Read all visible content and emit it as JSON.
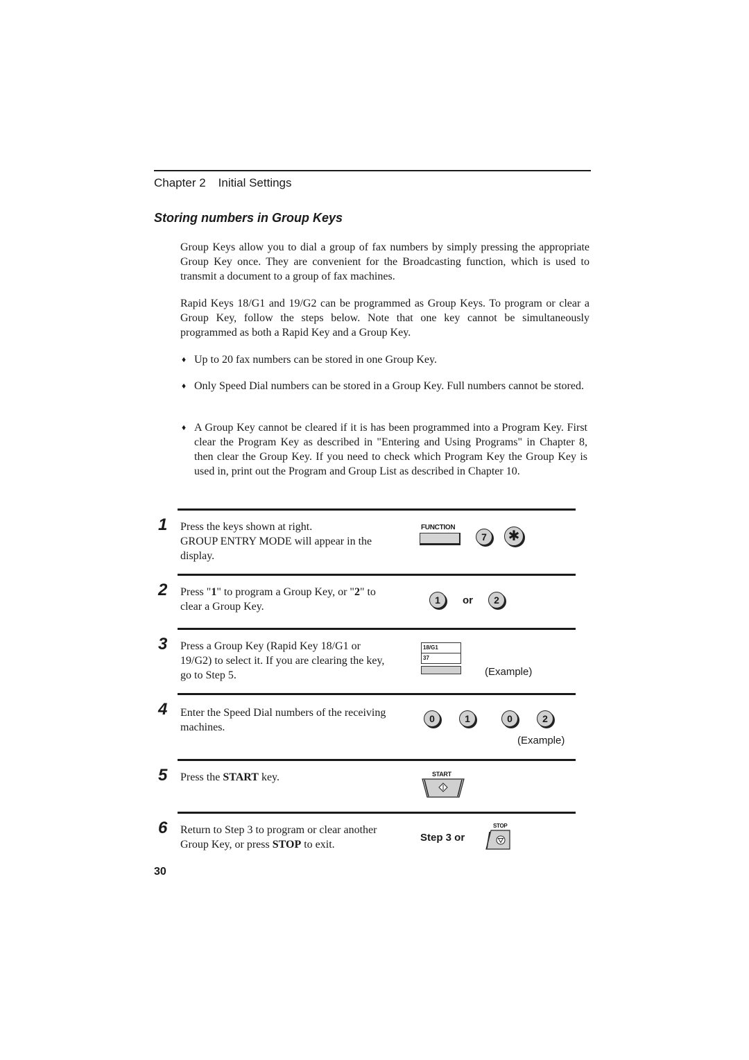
{
  "header": {
    "chapter_label": "Chapter 2",
    "chapter_title": "Initial Settings"
  },
  "section": {
    "title": "Storing numbers in Group Keys"
  },
  "intro": {
    "para1": "Group Keys allow you to dial a group of fax numbers by simply pressing the appropriate Group Key once. They are convenient for the Broadcasting function, which is used to transmit a document to a group of fax machines.",
    "para2": "Rapid Keys 18/G1 and 19/G2 can be programmed as Group Keys. To program or clear a Group Key, follow the steps below. Note that one key cannot be simultaneously programmed as both a Rapid Key and a Group Key."
  },
  "bullets": [
    {
      "icon": "diamond-bullet-icon",
      "glyph": "♦",
      "text": "Up to 20 fax numbers can be stored in one Group Key."
    },
    {
      "icon": "diamond-bullet-icon",
      "glyph": "♦",
      "text": "Only Speed Dial numbers can be stored in a Group Key. Full numbers cannot be stored."
    },
    {
      "icon": "diamond-bullet-icon",
      "glyph": "♦",
      "text": "A Group Key cannot be cleared if it is has been programmed into a Program Key. First clear the Program Key as described in \"Entering and Using Programs\" in Chapter 8, then clear the Group Key. If you need to check which Program Key the Group Key is used in, print out the Program and Group List as described in Chapter 10."
    }
  ],
  "steps": [
    {
      "number": "1",
      "text_line1": "Press the keys shown at right.",
      "text_line2": "GROUP ENTRY MODE will appear in the display.",
      "keys": {
        "function_label": "FUNCTION",
        "digit": "7",
        "star": "✱"
      }
    },
    {
      "number": "2",
      "text_a": "Press \"",
      "bold_a": "1",
      "text_b": "\" to program a Group Key, or \"",
      "bold_b": "2",
      "text_c": "\" to clear a Group Key.",
      "keys": {
        "first": "1",
        "or": "or",
        "second": "2"
      }
    },
    {
      "number": "3",
      "text": "Press a Group Key (Rapid Key 18/G1 or 19/G2) to select it. If you are clearing the key, go to Step 5.",
      "keys": {
        "rapid_top": "18/G1",
        "rapid_bottom": "37",
        "example": "(Example)"
      }
    },
    {
      "number": "4",
      "text": "Enter the Speed Dial numbers of the receiving machines.",
      "keys": {
        "digits": [
          "0",
          "1",
          "0",
          "2"
        ],
        "example": "(Example)"
      }
    },
    {
      "number": "5",
      "text_a": "Press the ",
      "bold": "START",
      "text_b": " key.",
      "keys": {
        "start_label": "START",
        "start_icon": "start-diamond-icon"
      }
    },
    {
      "number": "6",
      "text_a": "Return to Step 3 to program or clear another Group Key, or press ",
      "bold": "STOP",
      "text_b": " to exit.",
      "keys": {
        "step_ref": "Step 3 or",
        "stop_label": "STOP",
        "stop_icon": "stop-triangle-icon"
      }
    }
  ],
  "footer": {
    "page_number": "30"
  }
}
